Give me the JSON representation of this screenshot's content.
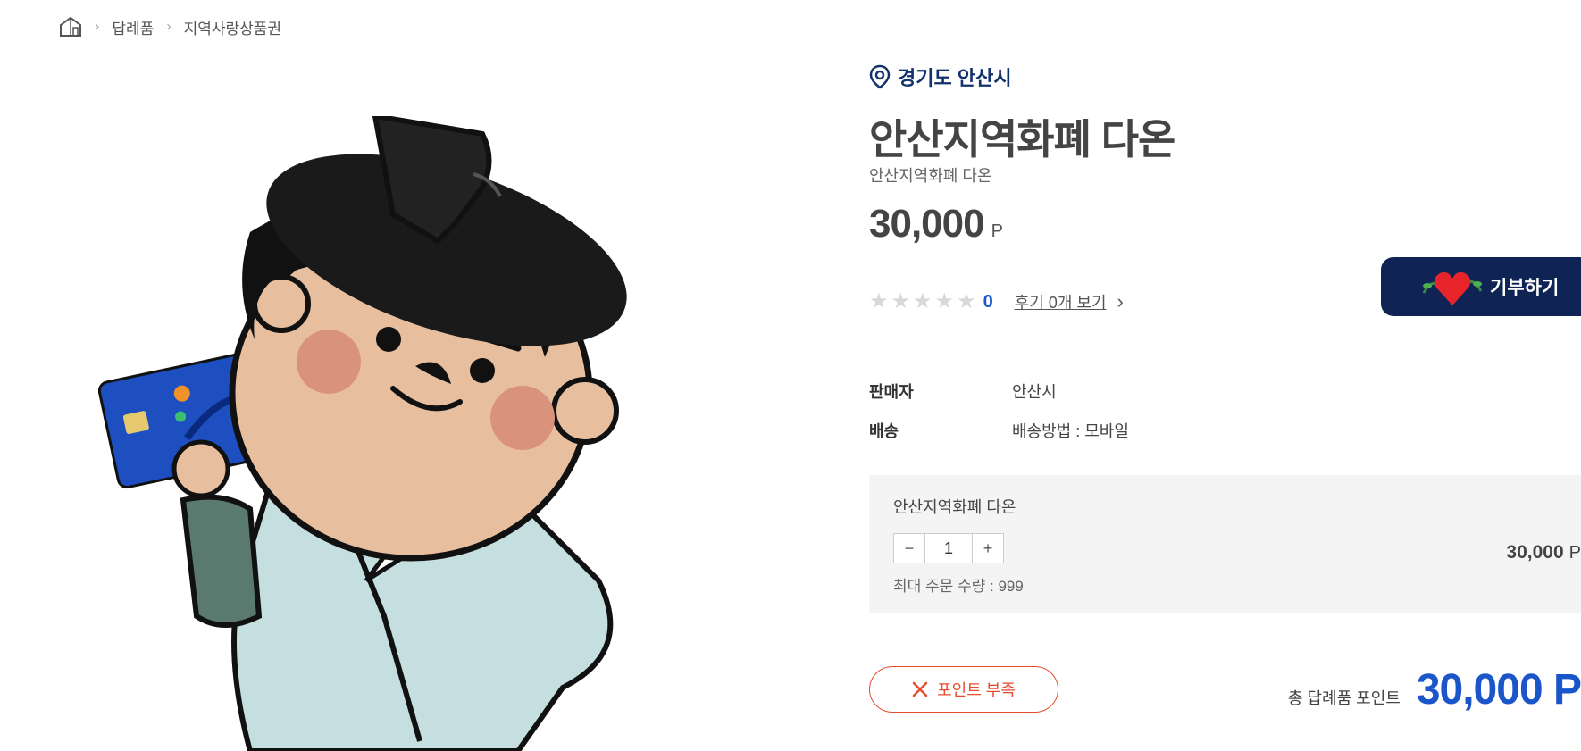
{
  "breadcrumb": {
    "items": [
      "답례품",
      "지역사랑상품권"
    ]
  },
  "product": {
    "region": "경기도 안산시",
    "title": "안산지역화폐 다온",
    "subtitle": "안산지역화폐 다온",
    "price": "30,000",
    "price_unit": "P",
    "rating_count": "0",
    "review_link": "후기 0개 보기",
    "donate_label": "기부하기",
    "seller_label": "판매자",
    "seller_value": "안산시",
    "shipping_label": "배송",
    "shipping_value": "배송방법 : 모바일"
  },
  "option": {
    "name": "안산지역화폐 다온",
    "quantity": "1",
    "minus": "−",
    "plus": "+",
    "max_order": "최대 주문 수량 : 999",
    "price": "30,000",
    "price_unit": "P"
  },
  "actions": {
    "insufficient_label": "포인트 부족"
  },
  "total": {
    "label": "총 답례품 포인트",
    "value": "30,000 P"
  },
  "colors": {
    "navy": "#0f2355",
    "accent_blue": "#1a55c9",
    "alert_red": "#e64b2e"
  }
}
